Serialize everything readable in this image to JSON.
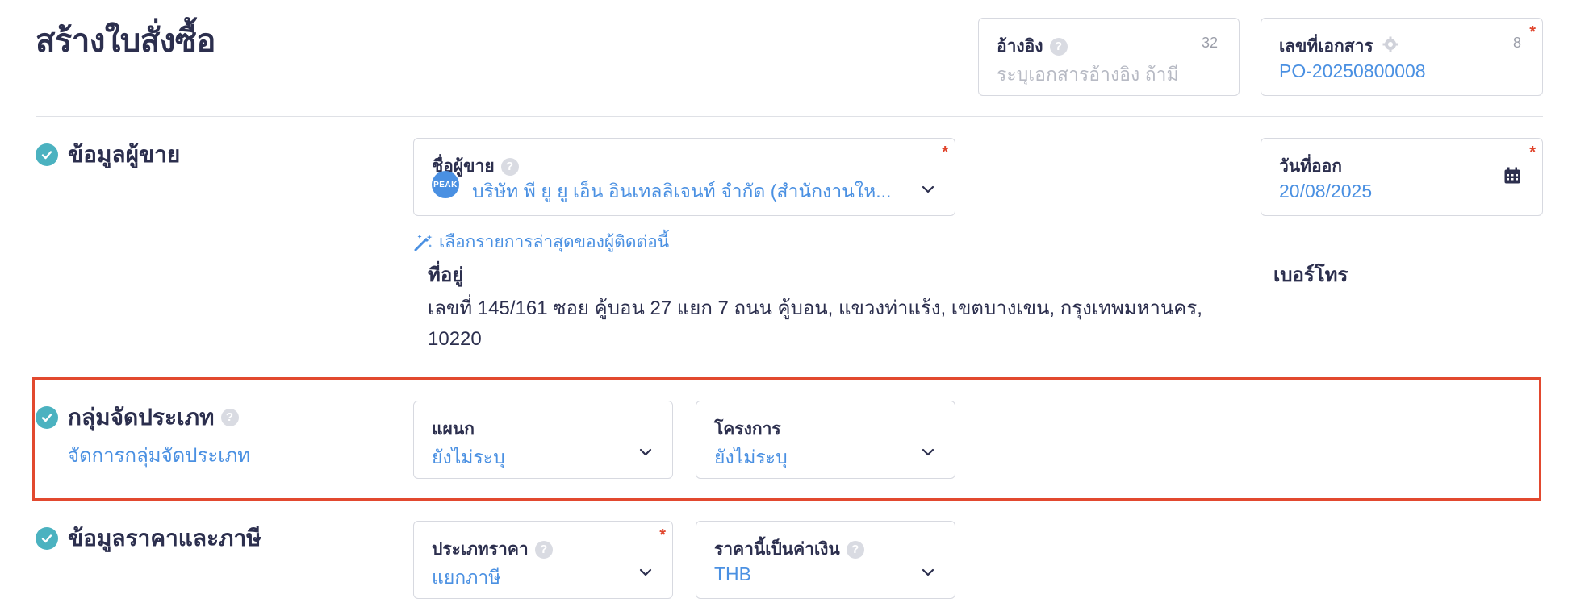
{
  "page": {
    "title": "สร้างใบสั่งซื้อ"
  },
  "reference": {
    "label": "อ้างอิง",
    "help": "?",
    "counter": "32",
    "placeholder": "ระบุเอกสารอ้างอิง ถ้ามี"
  },
  "doc_number": {
    "label": "เลขที่เอกสาร",
    "counter": "8",
    "required": "*",
    "value": "PO-20250800008"
  },
  "vendor_section": {
    "title": "ข้อมูลผู้ขาย",
    "vendor_name": {
      "label": "ชื่อผู้ขาย",
      "help": "?",
      "required": "*",
      "avatar_text": "PEAK",
      "value": "บริษัท พี ยู ยู เอ็น อินเทลลิเจนท์ จำกัด (สำนักงานให..."
    },
    "issue_date": {
      "label": "วันที่ออก",
      "required": "*",
      "value": "20/08/2025"
    },
    "latest_contact_link": "เลือกรายการล่าสุดของผู้ติดต่อนี้",
    "address_label": "ที่อยู่",
    "address_line1": "เลขที่ 145/161 ซอย คู้บอน 27 แยก 7 ถนน คู้บอน, แขวงท่าแร้ง, เขตบางเขน, กรุงเทพมหานคร,",
    "address_line2": "10220",
    "phone_label": "เบอร์โทร"
  },
  "category_section": {
    "title": "กลุ่มจัดประเภท",
    "help": "?",
    "manage_link": "จัดการกลุ่มจัดประเภท",
    "department": {
      "label": "แผนก",
      "value": "ยังไม่ระบุ"
    },
    "project": {
      "label": "โครงการ",
      "value": "ยังไม่ระบุ"
    },
    "highlight_color": "#e2492f"
  },
  "price_section": {
    "title": "ข้อมูลราคาและภาษี",
    "price_type": {
      "label": "ประเภทราคา",
      "help": "?",
      "required": "*",
      "value": "แยกภาษี"
    },
    "currency": {
      "label": "ราคานี้เป็นค่าเงิน",
      "help": "?",
      "value": "THB"
    }
  },
  "colors": {
    "accent": "#4a90e2",
    "check": "#4bb2c0",
    "required": "#e0442c"
  }
}
